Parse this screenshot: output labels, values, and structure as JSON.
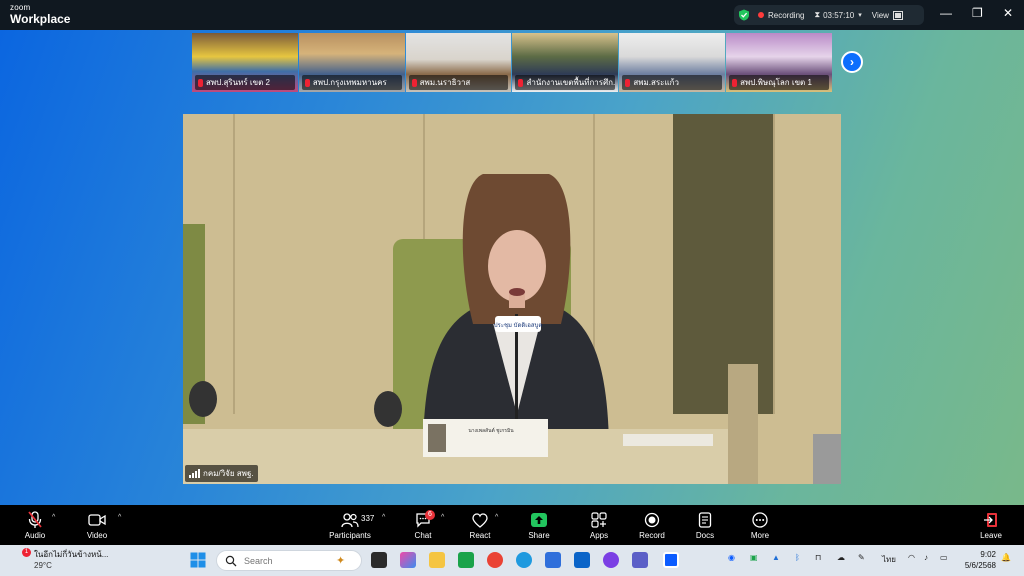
{
  "window": {
    "brand_small": "zoom",
    "brand_large": "Workplace",
    "recording_label": "Recording",
    "recording_time": "03:57:10",
    "view_label": "View"
  },
  "thumbnails": [
    {
      "label": "สพป.สุรินทร์ เขต 2"
    },
    {
      "label": "สพป.กรุงเทพมหานคร"
    },
    {
      "label": "สพม.นราธิวาส"
    },
    {
      "label": "สำนักงานเขตพื้นที่การศึก..."
    },
    {
      "label": "สพม.สระแก้ว"
    },
    {
      "label": "สพป.พิษณุโลก เขต 1"
    }
  ],
  "main_video": {
    "speaker_name": "กคม/วิจัย สพฐ.",
    "nameplate": "นางเพลสันต์ ชูเกรมิน",
    "sign_text": "ประชุม บัดดิเอสบูต"
  },
  "toolbar": {
    "audio": "Audio",
    "video": "Video",
    "participants": "Participants",
    "participants_count": "337",
    "chat": "Chat",
    "chat_badge": "6",
    "react": "React",
    "share": "Share",
    "apps": "Apps",
    "record": "Record",
    "docs": "Docs",
    "more": "More",
    "leave": "Leave"
  },
  "taskbar": {
    "weather_text": "ในอีกไม่กี่วันข้างหน้...",
    "weather_temp": "29°C",
    "weather_badge": "1",
    "search_placeholder": "Search",
    "language": "ไทย",
    "time": "9:02",
    "date": "5/6/2568"
  },
  "colors": {
    "titlebar": "#101820",
    "toolbar": "#000000",
    "share_green": "#22c55e",
    "accent_blue": "#0d6efd"
  }
}
